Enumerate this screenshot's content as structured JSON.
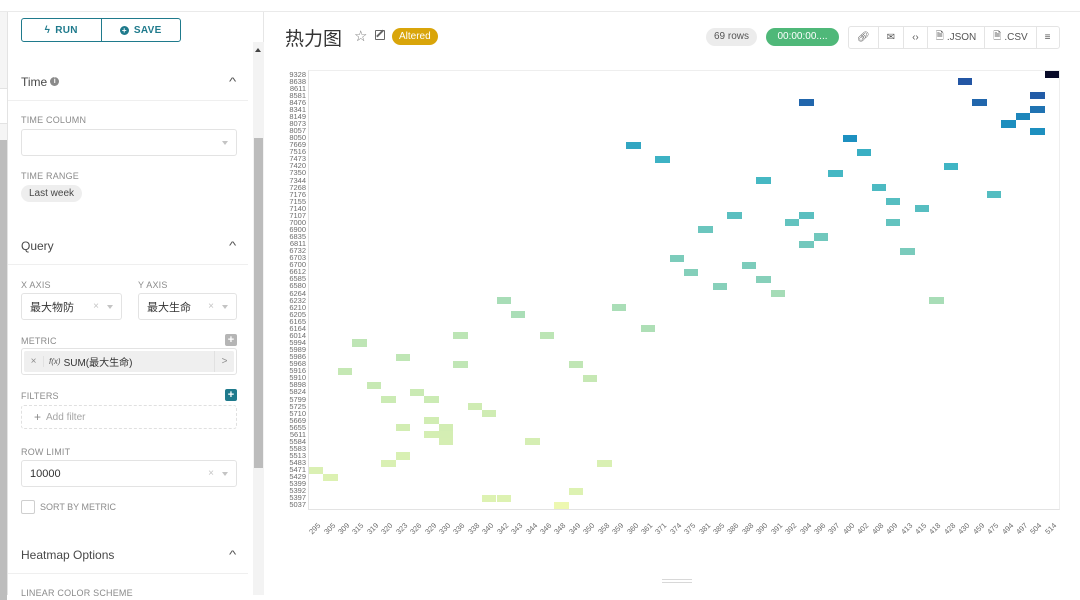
{
  "panel": {
    "run_label": "RUN",
    "save_label": "SAVE",
    "sections": {
      "time": {
        "title": "Time",
        "time_column_label": "TIME COLUMN",
        "time_column_value": "",
        "time_range_label": "TIME RANGE",
        "time_range_value": "Last week"
      },
      "query": {
        "title": "Query",
        "x_axis_label": "X AXIS",
        "x_axis_value": "最大物防",
        "y_axis_label": "Y AXIS",
        "y_axis_value": "最大生命",
        "metric_label": "METRIC",
        "metric_fx": "f(x)",
        "metric_value": "SUM(最大生命)",
        "filters_label": "FILTERS",
        "add_filter_placeholder": "Add filter",
        "row_limit_label": "ROW LIMIT",
        "row_limit_value": "10000",
        "sort_by_metric_label": "SORT BY METRIC",
        "sort_by_metric_checked": false
      },
      "heatmap": {
        "title": "Heatmap Options",
        "linear_color_scheme_label": "LINEAR COLOR SCHEME"
      }
    }
  },
  "header": {
    "title": "热力图",
    "status_badge": "Altered",
    "row_count": "69 rows",
    "timer": "00:00:00....",
    "toolbar": {
      "json_label": ".JSON",
      "csv_label": ".CSV"
    }
  },
  "colors": {
    "accent": "#1f7a8c",
    "altered": "#d9a50a",
    "timer": "#4fb879"
  },
  "chart_data": {
    "type": "heatmap",
    "title": "",
    "xlabel": "最大物防",
    "ylabel": "最大生命",
    "metric": "SUM(最大生命)",
    "color_scheme": "yellow-green-blue (low → high)",
    "x_categories": [
      "295",
      "305",
      "309",
      "315",
      "319",
      "320",
      "323",
      "326",
      "329",
      "330",
      "336",
      "338",
      "340",
      "342",
      "343",
      "344",
      "346",
      "348",
      "349",
      "350",
      "358",
      "359",
      "360",
      "361",
      "371",
      "374",
      "375",
      "381",
      "385",
      "386",
      "388",
      "390",
      "391",
      "392",
      "394",
      "396",
      "397",
      "400",
      "402",
      "408",
      "409",
      "413",
      "415",
      "418",
      "428",
      "430",
      "459",
      "475",
      "494",
      "497",
      "504",
      "514"
    ],
    "y_categories": [
      "9328",
      "8638",
      "8611",
      "8581",
      "8476",
      "8341",
      "8149",
      "8073",
      "8057",
      "8050",
      "7669",
      "7516",
      "7473",
      "7420",
      "7350",
      "7344",
      "7268",
      "7176",
      "7155",
      "7140",
      "7107",
      "7000",
      "6900",
      "6835",
      "6811",
      "6732",
      "6703",
      "6700",
      "6612",
      "6585",
      "6580",
      "6264",
      "6232",
      "6210",
      "6205",
      "6165",
      "6164",
      "6014",
      "5994",
      "5989",
      "5986",
      "5968",
      "5916",
      "5910",
      "5898",
      "5824",
      "5799",
      "5725",
      "5710",
      "5669",
      "5655",
      "5611",
      "5584",
      "5583",
      "5513",
      "5483",
      "5471",
      "5429",
      "5399",
      "5392",
      "5397",
      "5037"
    ],
    "cells": [
      {
        "x": "295",
        "y": "5471"
      },
      {
        "x": "305",
        "y": "5429"
      },
      {
        "x": "309",
        "y": "5916"
      },
      {
        "x": "315",
        "y": "5994"
      },
      {
        "x": "319",
        "y": "5898"
      },
      {
        "x": "320",
        "y": "5799"
      },
      {
        "x": "320",
        "y": "5483"
      },
      {
        "x": "323",
        "y": "5986"
      },
      {
        "x": "323",
        "y": "5655"
      },
      {
        "x": "323",
        "y": "5513"
      },
      {
        "x": "326",
        "y": "5824"
      },
      {
        "x": "329",
        "y": "5799"
      },
      {
        "x": "329",
        "y": "5669"
      },
      {
        "x": "329",
        "y": "5611"
      },
      {
        "x": "330",
        "y": "5655"
      },
      {
        "x": "330",
        "y": "5611"
      },
      {
        "x": "330",
        "y": "5584"
      },
      {
        "x": "336",
        "y": "6014"
      },
      {
        "x": "336",
        "y": "5968"
      },
      {
        "x": "338",
        "y": "5725"
      },
      {
        "x": "340",
        "y": "5710"
      },
      {
        "x": "340",
        "y": "5397"
      },
      {
        "x": "342",
        "y": "6232"
      },
      {
        "x": "342",
        "y": "5397"
      },
      {
        "x": "343",
        "y": "6205"
      },
      {
        "x": "344",
        "y": "5584"
      },
      {
        "x": "346",
        "y": "6014"
      },
      {
        "x": "348",
        "y": "5037"
      },
      {
        "x": "349",
        "y": "5968"
      },
      {
        "x": "349",
        "y": "5392"
      },
      {
        "x": "350",
        "y": "5910"
      },
      {
        "x": "358",
        "y": "5483"
      },
      {
        "x": "359",
        "y": "6210"
      },
      {
        "x": "360",
        "y": "7669"
      },
      {
        "x": "361",
        "y": "6164"
      },
      {
        "x": "371",
        "y": "7473"
      },
      {
        "x": "374",
        "y": "6703"
      },
      {
        "x": "375",
        "y": "6612"
      },
      {
        "x": "381",
        "y": "6900"
      },
      {
        "x": "385",
        "y": "6580"
      },
      {
        "x": "386",
        "y": "7107"
      },
      {
        "x": "388",
        "y": "6700"
      },
      {
        "x": "390",
        "y": "7344"
      },
      {
        "x": "390",
        "y": "6585"
      },
      {
        "x": "391",
        "y": "6264"
      },
      {
        "x": "392",
        "y": "7000"
      },
      {
        "x": "394",
        "y": "8476"
      },
      {
        "x": "394",
        "y": "7107"
      },
      {
        "x": "394",
        "y": "6811"
      },
      {
        "x": "396",
        "y": "6835"
      },
      {
        "x": "397",
        "y": "7350"
      },
      {
        "x": "400",
        "y": "8050"
      },
      {
        "x": "402",
        "y": "7516"
      },
      {
        "x": "408",
        "y": "7268"
      },
      {
        "x": "409",
        "y": "7155"
      },
      {
        "x": "409",
        "y": "7000"
      },
      {
        "x": "413",
        "y": "6732"
      },
      {
        "x": "415",
        "y": "7140"
      },
      {
        "x": "418",
        "y": "6232"
      },
      {
        "x": "428",
        "y": "7420"
      },
      {
        "x": "430",
        "y": "8638"
      },
      {
        "x": "459",
        "y": "8476"
      },
      {
        "x": "475",
        "y": "7176"
      },
      {
        "x": "494",
        "y": "8073"
      },
      {
        "x": "497",
        "y": "8149"
      },
      {
        "x": "504",
        "y": "8581"
      },
      {
        "x": "504",
        "y": "8341"
      },
      {
        "x": "504",
        "y": "8057"
      },
      {
        "x": "514",
        "y": "9328"
      }
    ]
  }
}
